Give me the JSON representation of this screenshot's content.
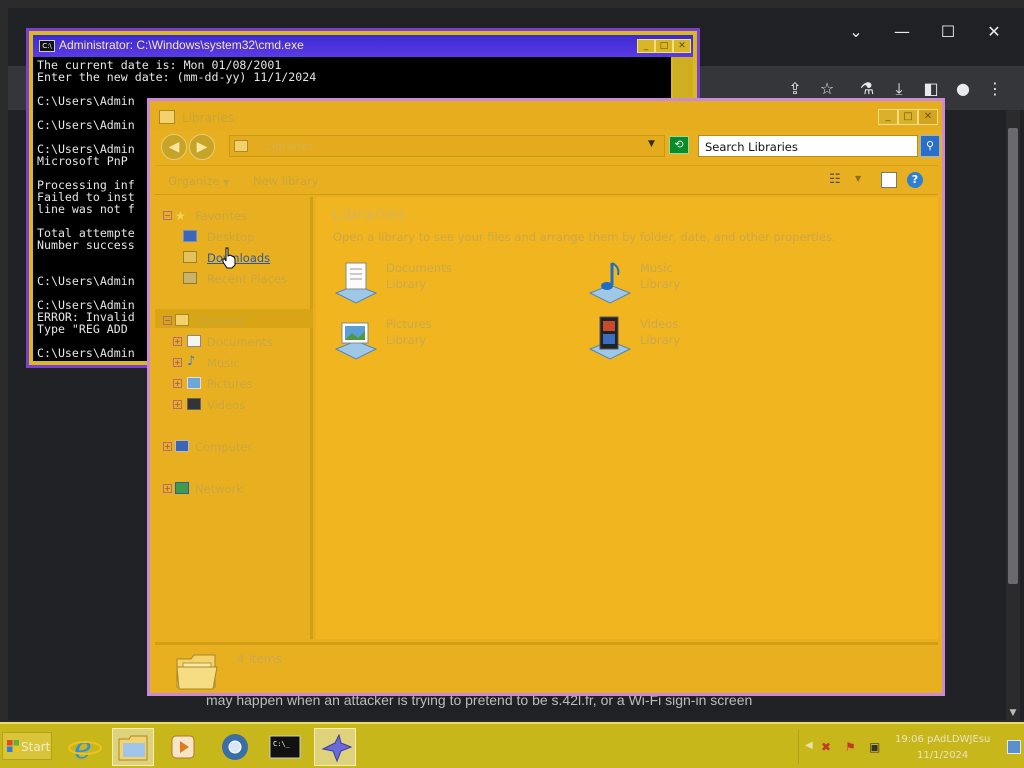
{
  "browser": {
    "window_controls": {
      "chevron": "⌄",
      "minimize": "—",
      "maximize": "☐",
      "close": "✕"
    },
    "toolbar_icons": [
      "share-icon",
      "star-icon",
      "flask-icon",
      "download-icon",
      "sidepanel-icon",
      "profile-icon",
      "menu-icon"
    ],
    "page_text": "may happen when an attacker is trying to pretend to be s.42l.fr, or a Wi-Fi sign-in screen"
  },
  "cmd": {
    "title": "Administrator: C:\\Windows\\system32\\cmd.exe",
    "lines": [
      "The current date is: Mon 01/08/2001",
      "Enter the new date: (mm-dd-yy) 11/1/2024",
      "",
      "C:\\Users\\Admin",
      "",
      "C:\\Users\\Admin",
      "",
      "C:\\Users\\Admin",
      "Microsoft PnP",
      "",
      "Processing inf",
      "Failed to inst",
      "line was not f",
      "",
      "Total attempte",
      "Number success",
      "",
      "",
      "C:\\Users\\Admin",
      "",
      "C:\\Users\\Admin",
      "ERROR: Invalid",
      "Type \"REG ADD",
      "",
      "C:\\Users\\Admin"
    ]
  },
  "explorer": {
    "title": "Libraries",
    "address": "Libraries",
    "search_placeholder": "Search Libraries",
    "commands": {
      "organize": "Organize",
      "new_library": "New library"
    },
    "nav": {
      "favorites": "Favorites",
      "desktop": "Desktop",
      "downloads": "Downloads",
      "recent_places": "Recent Places",
      "libraries": "Libraries",
      "documents": "Documents",
      "music": "Music",
      "pictures": "Pictures",
      "videos": "Videos",
      "computer": "Computer",
      "network": "Network"
    },
    "content": {
      "title": "Libraries",
      "subtitle": "Open a library to see your files and arrange them by folder, date, and other properties.",
      "libraries": [
        {
          "name": "Documents",
          "type": "Library",
          "icon": "documents-library-icon"
        },
        {
          "name": "Music",
          "type": "Library",
          "icon": "music-library-icon"
        },
        {
          "name": "Pictures",
          "type": "Library",
          "icon": "pictures-library-icon"
        },
        {
          "name": "Videos",
          "type": "Library",
          "icon": "videos-library-icon"
        }
      ]
    },
    "details": {
      "count_text": "4 items"
    }
  },
  "taskbar": {
    "start_label": "Start",
    "apps": [
      "internet-explorer-icon",
      "file-explorer-icon",
      "media-player-icon",
      "chrome-icon",
      "cmd-icon",
      "bird-app-icon"
    ],
    "clock_time": "19:06 pAdLDWJEsu",
    "clock_date": "11/1/2024"
  },
  "colors": {
    "explorer_bg": "#f0b51f",
    "cmd_title": "#3a2ad0",
    "taskbar": "#c8b71b",
    "browser_bg": "#202124"
  }
}
